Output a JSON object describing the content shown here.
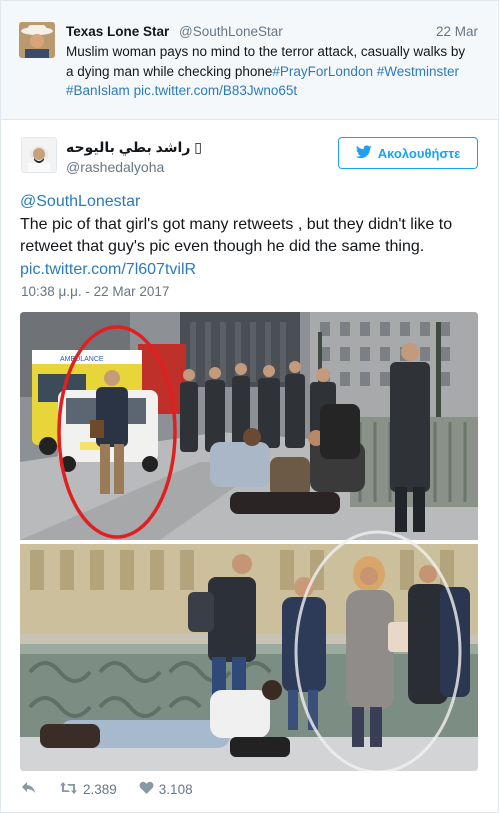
{
  "quoted_tweet": {
    "name": "Texas Lone Star",
    "handle": "@SouthLoneStar",
    "date": "22 Mar",
    "text": "Muslim woman pays no mind to the terror attack, casually walks by a dying man while checking phone",
    "hashtag1": "#PrayForLondon",
    "hashtag2": "#Westminster",
    "hashtag3": "#BanIslam",
    "link": "pic.twitter.com/B83Jwno65t"
  },
  "tweet": {
    "name": "راشد بطي باليوحه",
    "name_emoji": "▯",
    "handle": "@rashedalyoha",
    "follow_label": "Ακολουθήστε",
    "mention": "@SouthLonestar",
    "text": "The pic of that girl's got many retweets , but they didn't like to retweet that guy's pic even though he did the same thing.",
    "link": "pic.twitter.com/7l607tvilR",
    "timestamp": "10:38 μ.μ. - 22 Mar 2017"
  },
  "photo": {
    "ambulance_label": "AMBULANCE"
  },
  "actions": {
    "retweets": "2.389",
    "likes": "3.108"
  },
  "colors": {
    "twitter_blue": "#1da1f2",
    "link_blue": "#2b7bb9",
    "muted_gray": "#657786",
    "highlight_red": "#e02020"
  }
}
